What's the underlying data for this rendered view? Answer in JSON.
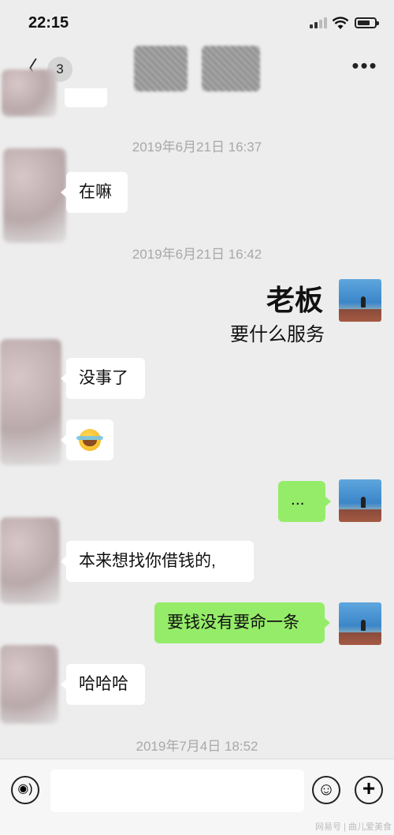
{
  "status_bar": {
    "time": "22:15"
  },
  "nav": {
    "back_badge": "3",
    "back_chevron": "〈",
    "more": "•••"
  },
  "timestamps": {
    "t1": "2019年6月21日 16:37",
    "t2": "2019年6月21日 16:42",
    "t3": "2019年7月4日 18:52"
  },
  "messages": {
    "m1": "在嘛",
    "sticker_line1": "老板",
    "sticker_line2": "要什么服务",
    "m2": "没事了",
    "m4": "...",
    "m5": "本来想找你借钱的,",
    "m6": "要钱没有要命一条",
    "m7": "哈哈哈"
  },
  "input_bar": {
    "voice_icon": "◉)",
    "emoji_icon": "☺",
    "plus_icon": "+"
  },
  "watermark": "网易号 | 曲儿爱美食",
  "colors": {
    "background": "#ededed",
    "bubble_out": "#95ec69",
    "bubble_in": "#ffffff"
  }
}
